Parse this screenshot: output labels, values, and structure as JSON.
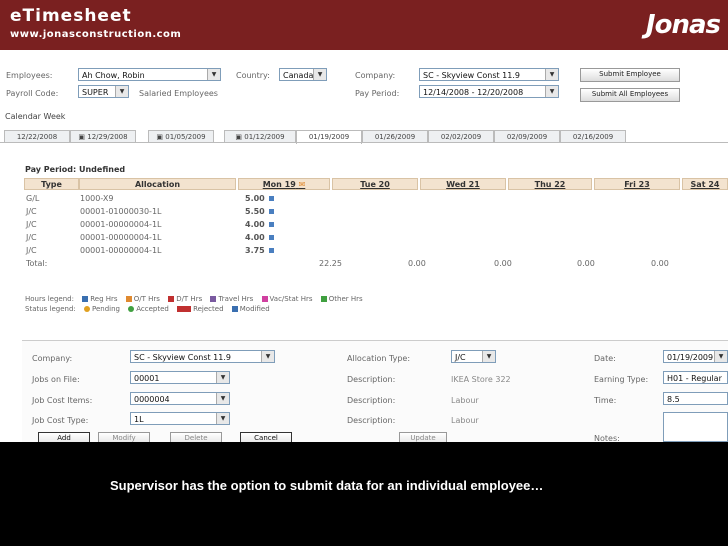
{
  "header": {
    "title": "eTimesheet",
    "url": "www.jonasconstruction.com",
    "logo_text": "Jonas"
  },
  "filters": {
    "employees_label": "Employees:",
    "employee_value": "Ah Chow, Robin",
    "country_label": "Country:",
    "country_value": "Canada",
    "company_label": "Company:",
    "company_value": "SC - Skyview Const 11.9",
    "payroll_code_label": "Payroll Code:",
    "payroll_code_value": "SUPER",
    "payroll_code_desc": "Salaried Employees",
    "pay_period_label": "Pay Period:",
    "pay_period_value": "12/14/2008 - 12/20/2008",
    "submit_employee": "Submit Employee",
    "submit_all": "Submit All Employees"
  },
  "calendar": {
    "label": "Calendar Week",
    "weeks": [
      "12/22/2008",
      "12/29/2008",
      "01/05/2009",
      "01/12/2009",
      "01/19/2009",
      "01/26/2009",
      "02/02/2009",
      "02/09/2009",
      "02/16/2009"
    ],
    "active_index": 4
  },
  "grid": {
    "pay_period": "Pay Period: Undefined",
    "headers": {
      "type": "Type",
      "allocation": "Allocation",
      "days": [
        "Mon 19",
        "Tue 20",
        "Wed 21",
        "Thu 22",
        "Fri 23",
        "Sat 24"
      ]
    },
    "rows": [
      {
        "type": "G/L",
        "allocation": "1000-X9",
        "mon": "5.00"
      },
      {
        "type": "J/C",
        "allocation": "00001-01000030-1L",
        "mon": "5.50"
      },
      {
        "type": "J/C",
        "allocation": "00001-00000004-1L",
        "mon": "4.00"
      },
      {
        "type": "J/C",
        "allocation": "00001-00000004-1L",
        "mon": "4.00"
      },
      {
        "type": "J/C",
        "allocation": "00001-00000004-1L",
        "mon": "3.75"
      }
    ],
    "total_label": "Total:",
    "totals": [
      "22.25",
      "0.00",
      "0.00",
      "0.00",
      "0.00"
    ]
  },
  "legend": {
    "hours_label": "Hours legend:",
    "hours_items": [
      {
        "label": "Reg Hrs",
        "color": "#3a6fb0"
      },
      {
        "label": "O/T Hrs",
        "color": "#e08a30"
      },
      {
        "label": "D/T Hrs",
        "color": "#c03030"
      },
      {
        "label": "Travel Hrs",
        "color": "#7a5aa0"
      },
      {
        "label": "Vac/Stat Hrs",
        "color": "#d040a0"
      },
      {
        "label": "Other Hrs",
        "color": "#40a040"
      }
    ],
    "status_label": "Status legend:",
    "status_items": [
      {
        "label": "Pending",
        "color": "#e0a020"
      },
      {
        "label": "Accepted",
        "color": "#40a040"
      },
      {
        "label": "Rejected",
        "color": "#c03030"
      },
      {
        "label": "Modified",
        "color": "#3a6fb0"
      }
    ]
  },
  "form": {
    "company_label": "Company:",
    "company_value": "SC - Skyview Const 11.9",
    "jobs_label": "Jobs on File:",
    "jobs_value": "00001",
    "items_label": "Job Cost Items:",
    "items_value": "0000004",
    "type_label": "Job Cost Type:",
    "type_value": "1L",
    "alloc_type_label": "Allocation Type:",
    "alloc_type_value": "J/C",
    "desc1_label": "Description:",
    "desc1_value": "IKEA Store 322",
    "desc2_label": "Description:",
    "desc2_value": "Labour",
    "desc3_label": "Description:",
    "desc3_value": "Labour",
    "date_label": "Date:",
    "date_value": "01/19/2009",
    "earning_label": "Earning Type:",
    "earning_value": "H01 - Regular",
    "time_label": "Time:",
    "time_value": "8.5",
    "notes_label": "Notes:",
    "buttons": {
      "add": "Add",
      "modify": "Modify",
      "delete": "Delete",
      "cancel": "Cancel",
      "update": "Update"
    }
  },
  "caption": {
    "text": "Supervisor has the option to submit data for an individual employee…"
  }
}
